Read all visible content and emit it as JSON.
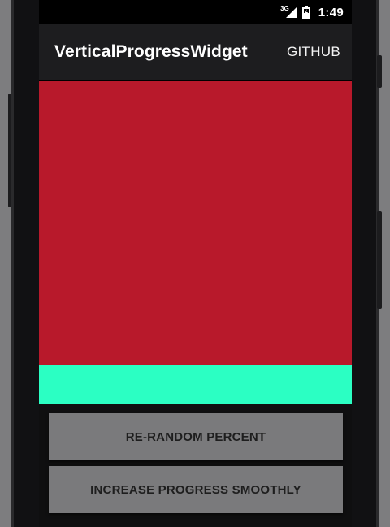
{
  "status_bar": {
    "network_type": "3G",
    "time": "1:49",
    "icons": [
      "signal-icon",
      "battery-icon"
    ]
  },
  "action_bar": {
    "title": "VerticalProgressWidget",
    "github_action": "GITHUB"
  },
  "progress": {
    "percent": 12,
    "progress_color": "#2bffc3",
    "background_color": "#b8192b"
  },
  "buttons": {
    "re_random": "RE-RANDOM PERCENT",
    "increase": "INCREASE PROGRESS SMOOTHLY"
  },
  "colors": {
    "action_bar": "#1d1d1f",
    "button": "#7a7a7c"
  }
}
